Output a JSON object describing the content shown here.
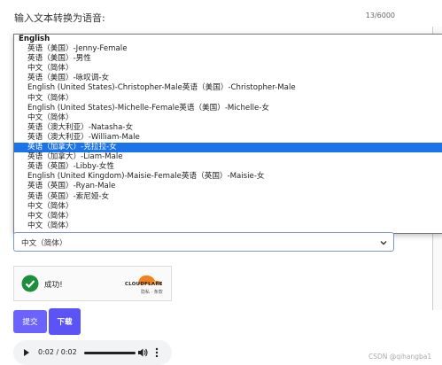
{
  "header": {
    "label": "输入文本转换为语音:",
    "counter": "13/6000"
  },
  "dropdown": {
    "group_label": "English",
    "options": [
      "英语（美国）-Jenny-Female",
      "英语（美国）-男性",
      "中文（简体）",
      "英语（美国）-咏叹调-女",
      "English (United States)-Christopher-Male英语（美国）-Christopher-Male",
      "中文（简体）",
      "English (United States)-Michelle-Female英语（美国）-Michelle-女",
      "中文（简体）",
      "英语（澳大利亚）-Natasha-女",
      "英语（澳大利亚）-William-Male",
      "英语（加拿大）-克拉拉-女",
      "英语（加拿大）-Liam-Male",
      "英语（英国）-Libby-女性",
      "English (United Kingdom)-Maisie-Female英语（英国）-Maisie-女",
      "英语（英国）-Ryan-Male",
      "英语（英国）-索尼娅-女",
      "中文（简体）",
      "中文（简体）",
      "中文（简体）"
    ],
    "selected_index": 10
  },
  "select": {
    "value": "中文（简体）"
  },
  "captcha": {
    "status": "成功!",
    "brand": "CLOUDFLARE",
    "sub": "隐私 · 条款",
    "brand_color": "#f38020",
    "check_color": "#1e8e3e"
  },
  "buttons": {
    "submit": "提交",
    "download": "下载",
    "accent": "#6c63ff"
  },
  "audio": {
    "time": "0:02 / 0:02"
  },
  "watermark": "CSDN @qihangba1"
}
